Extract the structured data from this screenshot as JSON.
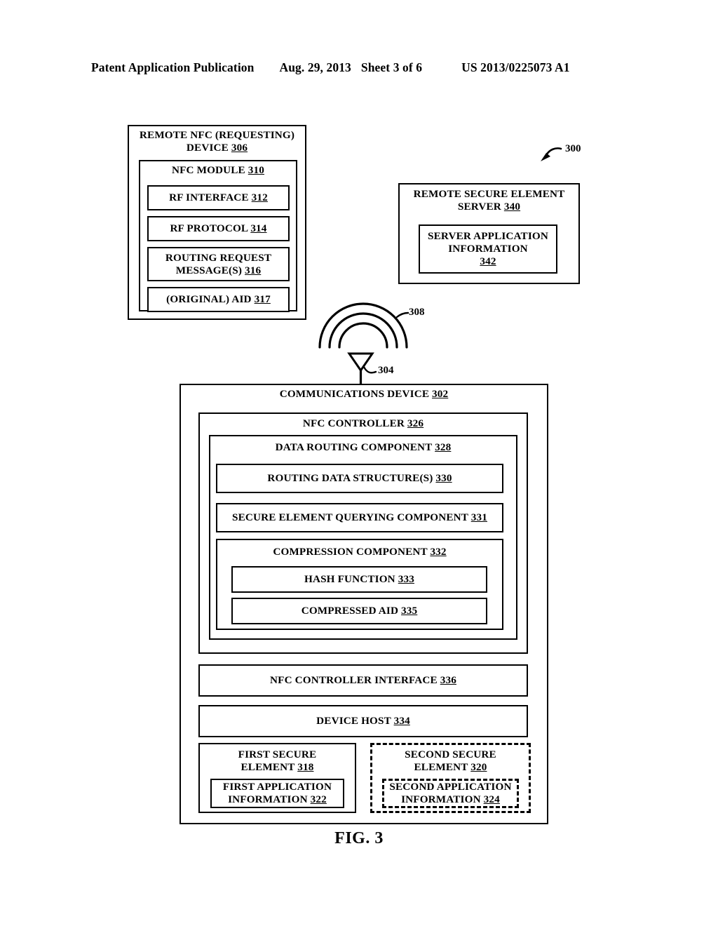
{
  "header": {
    "publication": "Patent Application Publication",
    "date": "Aug. 29, 2013",
    "sheet": "Sheet 3 of 6",
    "patent_number": "US 2013/0225073 A1"
  },
  "figure": {
    "caption": "FIG. 3",
    "system_ref": "300",
    "rf_field_ref": "308",
    "antenna_ref": "304"
  },
  "remote_device": {
    "title": "REMOTE NFC (REQUESTING)\nDEVICE ",
    "ref": "306",
    "nfc_module": {
      "title": "NFC MODULE ",
      "ref": "310",
      "items": [
        {
          "label": "RF INTERFACE ",
          "ref": "312"
        },
        {
          "label": "RF PROTOCOL ",
          "ref": "314"
        },
        {
          "label": "ROUTING REQUEST\nMESSAGE(S) ",
          "ref": "316"
        },
        {
          "label": "(ORIGINAL) AID ",
          "ref": "317"
        }
      ]
    }
  },
  "remote_server": {
    "title": "REMOTE SECURE ELEMENT\nSERVER ",
    "ref": "340",
    "inner": {
      "label": "SERVER APPLICATION\nINFORMATION\n",
      "ref": "342"
    }
  },
  "comm_device": {
    "title": "COMMUNICATIONS DEVICE ",
    "ref": "302",
    "nfc_controller": {
      "title": "NFC CONTROLLER ",
      "ref": "326",
      "data_routing": {
        "title": "DATA ROUTING COMPONENT ",
        "ref": "328",
        "routing_data_structures": {
          "label": "ROUTING DATA STRUCTURE(S) ",
          "ref": "330"
        },
        "secure_element_querying": {
          "label": "SECURE ELEMENT QUERYING COMPONENT ",
          "ref": "331"
        },
        "compression": {
          "title": "COMPRESSION COMPONENT ",
          "ref": "332",
          "hash_function": {
            "label": "HASH FUNCTION ",
            "ref": "333"
          },
          "compressed_aid": {
            "label": "COMPRESSED AID ",
            "ref": "335"
          }
        }
      }
    },
    "controller_interface": {
      "label": "NFC CONTROLLER INTERFACE  ",
      "ref": "336"
    },
    "device_host": {
      "label": "DEVICE HOST ",
      "ref": "334"
    },
    "first_secure_element": {
      "title": "FIRST SECURE\nELEMENT ",
      "ref": "318",
      "inner": {
        "label": "FIRST APPLICATION\nINFORMATION ",
        "ref": "322"
      }
    },
    "second_secure_element": {
      "title": "SECOND SECURE\nELEMENT ",
      "ref": "320",
      "inner": {
        "label": "SECOND APPLICATION\nINFORMATION ",
        "ref": "324"
      }
    }
  }
}
